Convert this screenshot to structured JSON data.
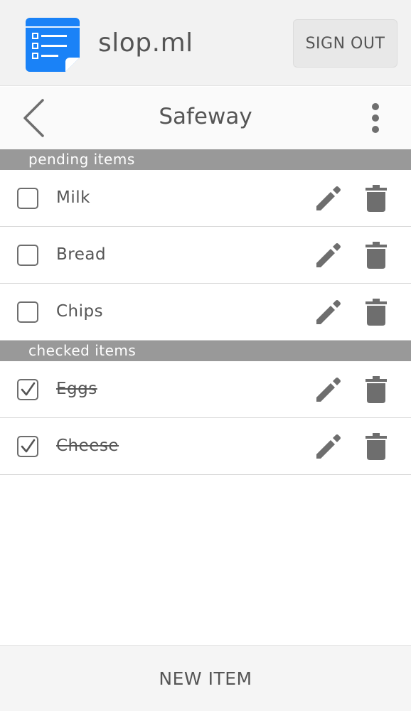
{
  "header": {
    "logo_icon": "checklist-document-icon",
    "app_name": "slop.ml",
    "sign_out_label": "SIGN OUT"
  },
  "list_bar": {
    "back_icon": "chevron-left-icon",
    "title": "Safeway",
    "menu_icon": "vertical-dots-icon"
  },
  "sections": {
    "pending": {
      "label": "pending items",
      "items": [
        {
          "name": "Milk",
          "checked": false
        },
        {
          "name": "Bread",
          "checked": false
        },
        {
          "name": "Chips",
          "checked": false
        }
      ]
    },
    "checked": {
      "label": "checked items",
      "items": [
        {
          "name": "Eggs",
          "checked": true
        },
        {
          "name": "Cheese",
          "checked": true
        }
      ]
    }
  },
  "row_icons": {
    "edit": "pencil-icon",
    "delete": "trash-icon"
  },
  "footer": {
    "new_item_label": "NEW ITEM"
  },
  "colors": {
    "brand_blue": "#1a82f7",
    "icon_gray": "#6e6e6e",
    "section_bar": "#999999"
  }
}
